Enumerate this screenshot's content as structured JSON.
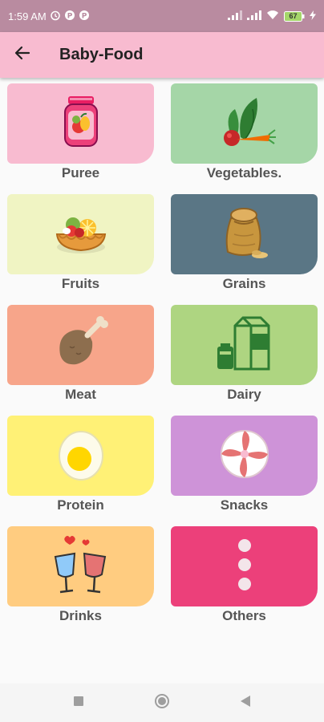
{
  "status_bar": {
    "time": "1:59 AM",
    "battery": "67",
    "icons": [
      "alarm-icon",
      "notification-p-icon",
      "notification-p-icon",
      "signal-icon",
      "signal-icon",
      "wifi-icon",
      "battery-icon",
      "charging-icon"
    ]
  },
  "app_bar": {
    "back_icon": "arrow-left-icon",
    "title": "Baby-Food"
  },
  "categories": [
    {
      "label": "Puree",
      "icon": "baby-food-jar-icon",
      "color": "#f8bbd0"
    },
    {
      "label": "Vegetables.",
      "icon": "vegetables-icon",
      "color": "#a5d6a7"
    },
    {
      "label": "Fruits",
      "icon": "fruit-tart-icon",
      "color": "#f0f4c3"
    },
    {
      "label": "Grains",
      "icon": "grain-sack-icon",
      "color": "#5a7685"
    },
    {
      "label": "Meat",
      "icon": "chicken-leg-icon",
      "color": "#f7a58a"
    },
    {
      "label": "Dairy",
      "icon": "milk-carton-icon",
      "color": "#aed581"
    },
    {
      "label": "Protein",
      "icon": "boiled-egg-icon",
      "color": "#fff176"
    },
    {
      "label": "Snacks",
      "icon": "peppermint-candy-icon",
      "color": "#ce93d8"
    },
    {
      "label": "Drinks",
      "icon": "toasting-glasses-icon",
      "color": "#ffcc80"
    },
    {
      "label": "Others",
      "icon": "more-dots-icon",
      "color": "#ec407a"
    }
  ],
  "nav_bar": {
    "icons": [
      "recents-square-icon",
      "home-circle-icon",
      "back-triangle-icon"
    ]
  }
}
